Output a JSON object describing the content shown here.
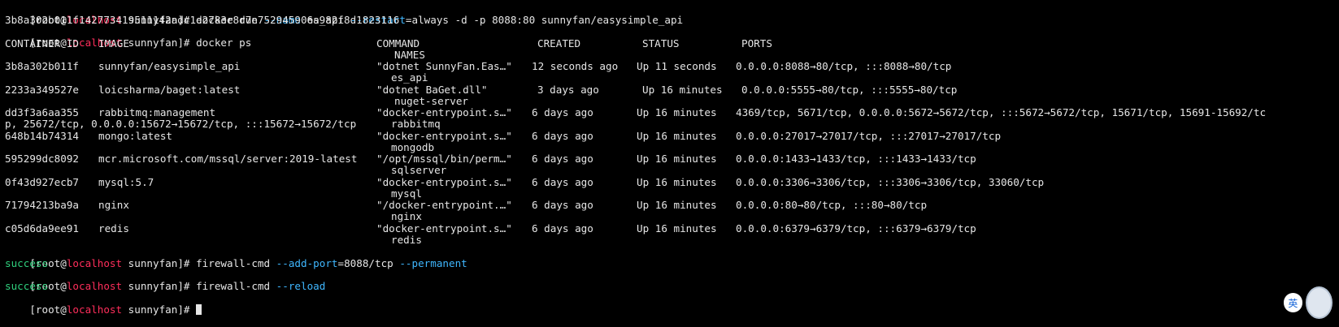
{
  "prompt": {
    "open": "[root@",
    "host": "localhost",
    "dir": " sunnyfan]# "
  },
  "lines": {
    "l1_cmd": "docker run ",
    "l1_name_opt": "--name",
    "l1_name_val": " es_api ",
    "l1_restart_opt": "--restart",
    "l1_rest": "=always -d -p 8088:80 sunnyfan/easysimple_api",
    "l2_hash": "3b8a302b011f142773419511142adc1e2783e8d7e752945906a982f8d1823116",
    "l3_cmd": "docker ps",
    "hdr_container": "CONTAINER ID",
    "hdr_image": "IMAGE",
    "hdr_command": "COMMAND",
    "hdr_created": "CREATED",
    "hdr_status": "STATUS",
    "hdr_ports": "PORTS",
    "hdr_names": "NAMES"
  },
  "containers": [
    {
      "id": "3b8a302b011f",
      "image": "sunnyfan/easysimple_api",
      "command": "\"dotnet SunnyFan.Eas…\"",
      "created": "12 seconds ago",
      "status": "Up 11 seconds",
      "ports": "0.0.0.0:8088→80/tcp, :::8088→80/tcp",
      "name": "es_api"
    },
    {
      "id": "2233a349527e",
      "image": "loicsharma/baget:latest",
      "command": "\"dotnet BaGet.dll\"",
      "created": "3 days ago",
      "status": "Up 16 minutes",
      "ports": "0.0.0.0:5555→80/tcp, :::5555→80/tcp",
      "name": "nuget-server"
    },
    {
      "id": "dd3f3a6aa355",
      "image": "rabbitmq:management",
      "command": "\"docker-entrypoint.s…\"",
      "created": "6 days ago",
      "status": "Up 16 minutes",
      "ports": "4369/tcp, 5671/tcp, 0.0.0.0:5672→5672/tcp, :::5672→5672/tcp, 15671/tcp, 15691-15692/tc",
      "ports_wrap": "p, 25672/tcp, 0.0.0.0:15672→15672/tcp, :::15672→15672/tcp",
      "name": "rabbitmq"
    },
    {
      "id": "648b14b74314",
      "image": "mongo:latest",
      "command": "\"docker-entrypoint.s…\"",
      "created": "6 days ago",
      "status": "Up 16 minutes",
      "ports": "0.0.0.0:27017→27017/tcp, :::27017→27017/tcp",
      "name": "mongodb"
    },
    {
      "id": "595299dc8092",
      "image": "mcr.microsoft.com/mssql/server:2019-latest",
      "command": "\"/opt/mssql/bin/perm…\"",
      "created": "6 days ago",
      "status": "Up 16 minutes",
      "ports": "0.0.0.0:1433→1433/tcp, :::1433→1433/tcp",
      "name": "sqlserver"
    },
    {
      "id": "0f43d927ecb7",
      "image": "mysql:5.7",
      "command": "\"docker-entrypoint.s…\"",
      "created": "6 days ago",
      "status": "Up 16 minutes",
      "ports": "0.0.0.0:3306→3306/tcp, :::3306→3306/tcp, 33060/tcp",
      "name": "mysql"
    },
    {
      "id": "71794213ba9a",
      "image": "nginx",
      "command": "\"/docker-entrypoint.…\"",
      "created": "6 days ago",
      "status": "Up 16 minutes",
      "ports": "0.0.0.0:80→80/tcp, :::80→80/tcp",
      "name": "nginx"
    },
    {
      "id": "c05d6da9ee91",
      "image": "redis",
      "command": "\"docker-entrypoint.s…\"",
      "created": "6 days ago",
      "status": "Up 16 minutes",
      "ports": "0.0.0.0:6379→6379/tcp, :::6379→6379/tcp",
      "name": "redis"
    }
  ],
  "firewall": {
    "cmd1": "firewall-cmd ",
    "cmd1_opt1": "--add-port",
    "cmd1_mid": "=8088/tcp ",
    "cmd1_opt2": "--permanent",
    "success1": "success",
    "cmd2": "firewall-cmd ",
    "cmd2_opt": "--reload",
    "success2": "success"
  },
  "ime": {
    "label": "英"
  },
  "colors": {
    "background": "#000000",
    "text": "#e6e6e6",
    "host": "#ff2e5b",
    "option": "#3fb7ff",
    "success": "#2fd07d"
  }
}
